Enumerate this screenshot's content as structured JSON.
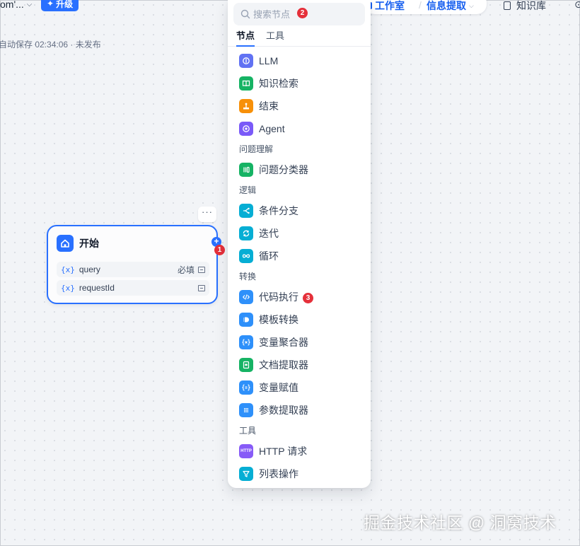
{
  "header": {
    "app_name": "om'...",
    "upgrade_label": "升级",
    "nav_studio": "工作室",
    "nav_app": "信息提取",
    "nav_knowledge": "知识库"
  },
  "save_status": "自动保存 02:34:06 · 未发布",
  "start_node": {
    "title": "开始",
    "variables": [
      {
        "icon": "{x}",
        "name": "query",
        "required": "必填"
      },
      {
        "icon": "{x}",
        "name": "requestId",
        "required": ""
      }
    ],
    "more": "···"
  },
  "badges": {
    "one": "1",
    "two": "2",
    "three": "3"
  },
  "panel": {
    "search_placeholder": "搜索节点",
    "tabs": [
      "节点",
      "工具"
    ],
    "items": {
      "llm": "LLM",
      "knowledge": "知识检索",
      "end": "结束",
      "agent": "Agent",
      "classifier": "问题分类器",
      "if_else": "条件分支",
      "iteration": "迭代",
      "loop": "循环",
      "code": "代码执行",
      "template": "模板转换",
      "aggregator": "变量聚合器",
      "doc_extractor": "文档提取器",
      "assigner": "变量赋值",
      "param_extractor": "参数提取器",
      "http": "HTTP 请求",
      "list_op": "列表操作"
    },
    "sections": {
      "understanding": "问题理解",
      "logic": "逻辑",
      "transform": "转换",
      "tools": "工具"
    },
    "http_icon_text": "HTTP"
  },
  "colors": {
    "accent": "#2970ff",
    "badge": "#e5303a",
    "llm": "#6172f3",
    "knowledge": "#16b364",
    "end": "#f79009",
    "agent": "#7a5af8",
    "classifier": "#16b364",
    "logic": "#06aed4",
    "code": "#2e90fa",
    "doc": "#16b364",
    "http": "#875bf7"
  },
  "watermark": "掘金技术社区 @ 洞窝技术"
}
